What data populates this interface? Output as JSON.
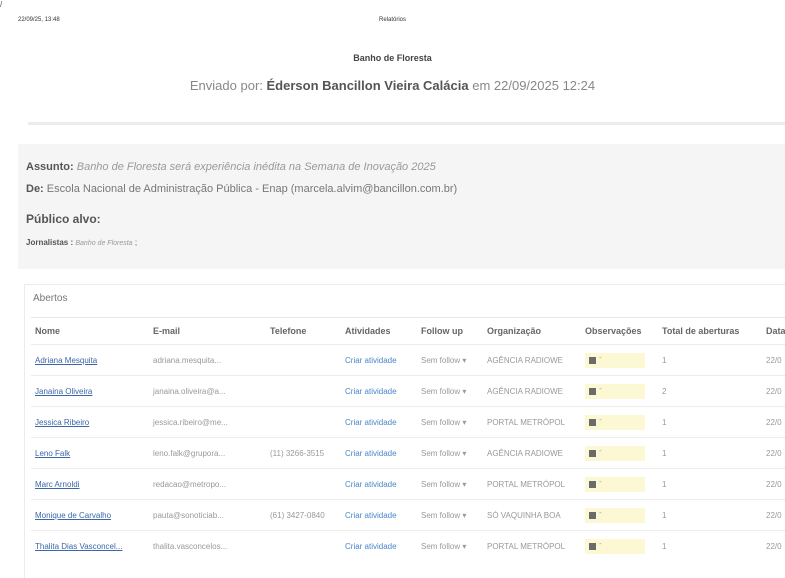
{
  "print_header": {
    "corner_mark": "/",
    "datetime": "22/09/25, 13:48",
    "title": "Relatórios"
  },
  "report": {
    "title": "Banho de Floresta",
    "sent_by_prefix": "Enviado por:",
    "sender": "Éderson Bancillon Vieira Calácia",
    "sent_at": "em 22/09/2025 12:24"
  },
  "info": {
    "subject_label": "Assunto:",
    "subject": "Banho de Floresta será experiência inédita na Semana de Inovação 2025",
    "from_label": "De:",
    "from": "Escola Nacional de Administração Pública - Enap (marcela.alvim@bancillon.com.br)",
    "audience_label": "Público alvo:",
    "audience_group": "Jornalistas :",
    "audience_tag": "Banho de Floresta",
    "audience_sep": ";"
  },
  "opened": {
    "title": "Abertos",
    "columns": [
      "Nome",
      "E-mail",
      "Telefone",
      "Atividades",
      "Follow up",
      "Organização",
      "Observações",
      "Total de aberturas",
      "Data"
    ],
    "rows": [
      {
        "name": "Adriana Mesquita",
        "email": "adriana.mesquita...",
        "phone": "",
        "activity": "Criar atividade",
        "follow": "Sem follow ▾",
        "org": "AGÊNCIA RADIOWE",
        "obs": "-",
        "opens": "1",
        "date": "22/0"
      },
      {
        "name": "Janaina Oliveira",
        "email": "janaina.oliveira@a...",
        "phone": "",
        "activity": "Criar atividade",
        "follow": "Sem follow ▾",
        "org": "AGÊNCIA RADIOWE",
        "obs": "-",
        "opens": "2",
        "date": "22/0"
      },
      {
        "name": "Jessica Ribeiro",
        "email": "jessica.ribeiro@me...",
        "phone": "",
        "activity": "Criar atividade",
        "follow": "Sem follow ▾",
        "org": "PORTAL METRÓPOL",
        "obs": "-",
        "opens": "1",
        "date": "22/0"
      },
      {
        "name": "Leno Falk",
        "email": "leno.falk@grupora...",
        "phone": "(11) 3266-3515",
        "activity": "Criar atividade",
        "follow": "Sem follow ▾",
        "org": "AGÊNCIA RADIOWE",
        "obs": "-",
        "opens": "1",
        "date": "22/0"
      },
      {
        "name": "Marc Arnoldi",
        "email": "redacao@metropo...",
        "phone": "",
        "activity": "Criar atividade",
        "follow": "Sem follow ▾",
        "org": "PORTAL METRÓPOL",
        "obs": "-",
        "opens": "1",
        "date": "22/0"
      },
      {
        "name": "Monique de Carvalho",
        "email": "pauta@sonoticiab...",
        "phone": "(61) 3427-0840",
        "activity": "Criar atividade",
        "follow": "Sem follow ▾",
        "org": "SÓ VAQUINHA BOA",
        "obs": "-",
        "opens": "1",
        "date": "22/0"
      },
      {
        "name": "Thalita Dias Vasconcel...",
        "email": "thalita.vasconcelos...",
        "phone": "",
        "activity": "Criar atividade",
        "follow": "Sem follow ▾",
        "org": "PORTAL METRÓPOL",
        "obs": "-",
        "opens": "1",
        "date": "22/0"
      }
    ]
  }
}
